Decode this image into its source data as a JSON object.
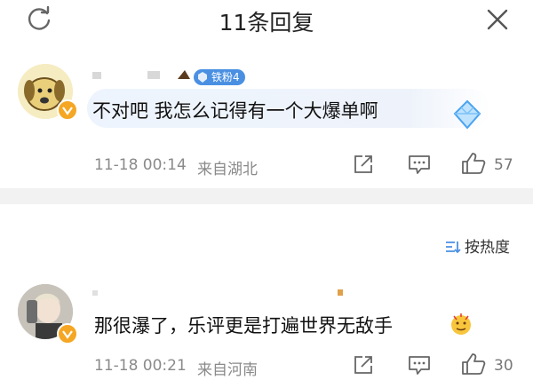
{
  "header": {
    "title": "11条回复"
  },
  "comments": [
    {
      "fan_badge": "铁粉4",
      "text": "不对吧 我怎么记得有一个大爆单啊",
      "time": "11-18 00:14",
      "location": "来自湖北",
      "likes": "57"
    },
    {
      "text": "那很瀑了，乐评更是打遍世界无敌手",
      "time": "11-18 00:21",
      "location": "来自河南",
      "likes": "30"
    }
  ],
  "sort": {
    "label": "按热度"
  },
  "colors": {
    "accent": "#4a90e2",
    "verified": "#f5a623",
    "divider": "#f2f2f2"
  }
}
